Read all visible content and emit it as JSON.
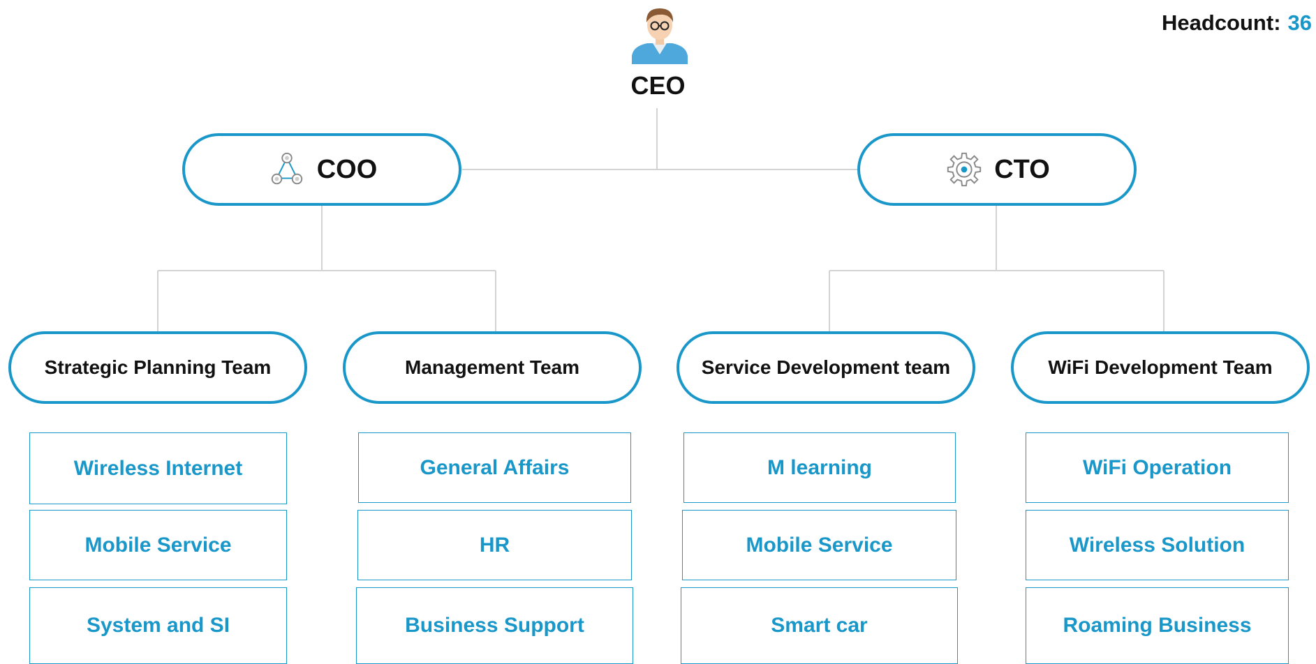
{
  "headcount": {
    "label": "Headcount:",
    "value": "36"
  },
  "ceo": {
    "label": "CEO",
    "icon": "person-avatar-icon"
  },
  "executives": [
    {
      "label": "COO",
      "icon": "network-triangle-icon"
    },
    {
      "label": "CTO",
      "icon": "gear-icon"
    }
  ],
  "teams": [
    {
      "label": "Strategic Planning Team",
      "units": [
        "Wireless Internet",
        "Mobile Service",
        "System and SI"
      ]
    },
    {
      "label": "Management Team",
      "units": [
        "General Affairs",
        "HR",
        "Business Support"
      ]
    },
    {
      "label": "Service Development team",
      "units": [
        "M learning",
        "Mobile Service",
        "Smart car"
      ]
    },
    {
      "label": "WiFi Development Team",
      "units": [
        "WiFi Operation",
        "Wireless Solution",
        "Roaming Business"
      ]
    }
  ],
  "colors": {
    "accent": "#1a97c9",
    "connector": "#d0d0d0",
    "text": "#111111"
  }
}
